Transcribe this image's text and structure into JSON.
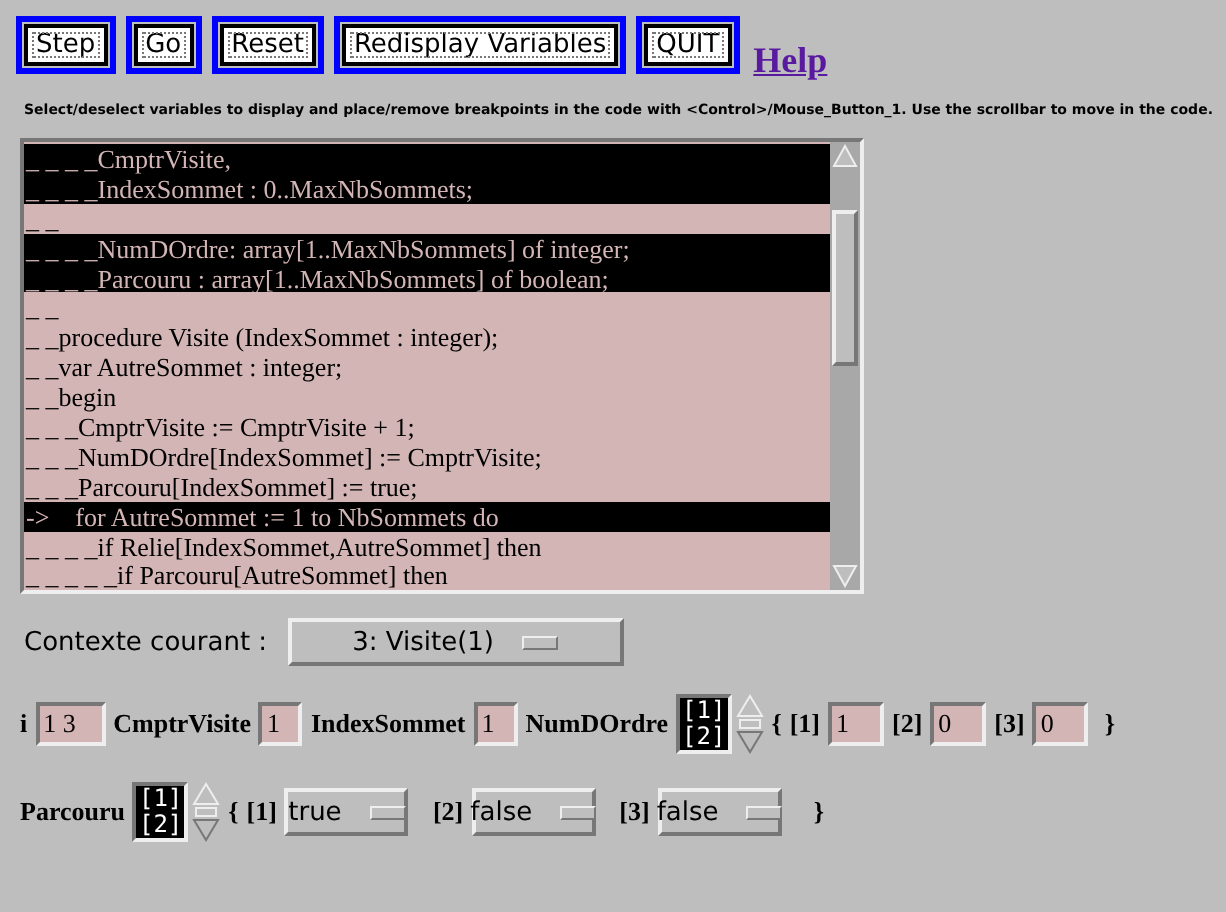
{
  "toolbar": {
    "buttons": [
      "Step",
      "Go",
      "Reset",
      "Redisplay Variables",
      "QUIT"
    ],
    "help_link": "Help"
  },
  "instructions": "Select/deselect variables to display and place/remove breakpoints in the code with <Control>/Mouse_Button_1. Use the scrollbar to move in the code.",
  "code": {
    "lines": [
      {
        "text": "_ _ _ _CmptrVisite,",
        "selected": true
      },
      {
        "text": "_ _ _ _IndexSommet : 0..MaxNbSommets;",
        "selected": true
      },
      {
        "text": "_ _",
        "selected": false
      },
      {
        "text": "_ _ _ _NumDOrdre: array[1..MaxNbSommets] of integer;",
        "selected": true
      },
      {
        "text": "_ _ _ _Parcouru : array[1..MaxNbSommets] of boolean;",
        "selected": true
      },
      {
        "text": "_ _",
        "selected": false
      },
      {
        "text": "_ _procedure Visite (IndexSommet : integer);",
        "selected": false
      },
      {
        "text": "_ _var AutreSommet : integer;",
        "selected": false
      },
      {
        "text": "_ _begin",
        "selected": false
      },
      {
        "text": "_ _ _CmptrVisite := CmptrVisite + 1;",
        "selected": false
      },
      {
        "text": "_ _ _NumDOrdre[IndexSommet] := CmptrVisite;",
        "selected": false
      },
      {
        "text": "_ _ _Parcouru[IndexSommet] := true;",
        "selected": false
      },
      {
        "text": "->    for AutreSommet := 1 to NbSommets do",
        "selected": true
      },
      {
        "text": "_ _ _ _if Relie[IndexSommet,AutreSommet] then",
        "selected": false
      },
      {
        "text": "_ _ _ _ _if Parcouru[AutreSommet] then",
        "selected": false
      }
    ]
  },
  "context": {
    "label": "Contexte courant :",
    "value": "3: Visite(1)"
  },
  "variables": [
    [
      {
        "kind": "scalar",
        "label": "i",
        "value": "1 3"
      },
      {
        "kind": "scalar",
        "label": "CmptrVisite",
        "value": "1"
      },
      {
        "kind": "scalar",
        "label": "IndexSommet",
        "value": "1"
      },
      {
        "kind": "array",
        "label": "NumDOrdre",
        "list": [
          "[1]",
          "[2]"
        ],
        "open": "{",
        "close": "}",
        "elements": [
          {
            "kind": "field",
            "index": "[1]",
            "value": "1"
          },
          {
            "kind": "field",
            "index": "[2]",
            "value": "0"
          },
          {
            "kind": "field",
            "index": "[3]",
            "value": "0"
          }
        ]
      }
    ],
    [
      {
        "kind": "array",
        "label": "Parcouru",
        "list": [
          "[1]",
          "[2]"
        ],
        "open": "{",
        "close": "}",
        "elements": [
          {
            "kind": "menu",
            "index": "[1]",
            "value": "true"
          },
          {
            "kind": "menu",
            "index": "[2]",
            "value": "false"
          },
          {
            "kind": "menu",
            "index": "[3]",
            "value": "false"
          }
        ]
      }
    ]
  ]
}
